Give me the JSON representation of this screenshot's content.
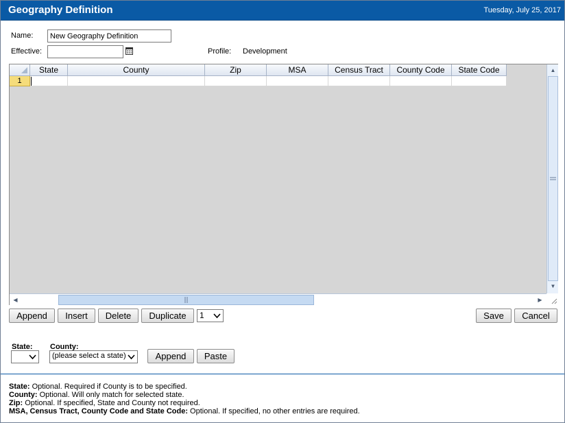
{
  "header": {
    "title": "Geography Definition",
    "date": "Tuesday, July 25, 2017"
  },
  "form": {
    "name_label": "Name:",
    "name_value": "New Geography Definition",
    "effective_label": "Effective:",
    "effective_value": "",
    "profile_label": "Profile:",
    "profile_value": "Development"
  },
  "grid": {
    "columns": [
      "State",
      "County",
      "Zip",
      "MSA",
      "Census Tract",
      "County Code",
      "State Code"
    ],
    "rows": [
      {
        "row_number": "1",
        "cells": [
          "",
          "",
          "",
          "",
          "",
          "",
          ""
        ]
      }
    ]
  },
  "toolbar": {
    "append_label": "Append",
    "insert_label": "Insert",
    "delete_label": "Delete",
    "duplicate_label": "Duplicate",
    "duplicate_count": "1",
    "save_label": "Save",
    "cancel_label": "Cancel"
  },
  "filter": {
    "state_label": "State:",
    "state_value": "",
    "county_label": "County:",
    "county_value": "(please select a state)",
    "append_label": "Append",
    "paste_label": "Paste"
  },
  "help": [
    {
      "term": "State:",
      "text": " Optional. Required if County is to be specified."
    },
    {
      "term": "County:",
      "text": " Optional. Will only match for selected state."
    },
    {
      "term": "Zip:",
      "text": " Optional. If specified, State and County not required."
    },
    {
      "term": "MSA, Census Tract, County Code and State Code:",
      "text": " Optional. If specified, no other entries are required."
    }
  ],
  "icons": {
    "calendar": "calendar-icon",
    "dropdown": "chevron-down-icon",
    "scroll_up": "arrow-up-icon",
    "scroll_down": "arrow-down-icon",
    "scroll_left": "arrow-left-icon",
    "scroll_right": "arrow-right-icon",
    "resize": "resize-grip-icon"
  },
  "colors": {
    "titlebar": "#0a5aa5",
    "grid_background": "#d6d6d6",
    "row_marker": "#f5dc7b"
  }
}
